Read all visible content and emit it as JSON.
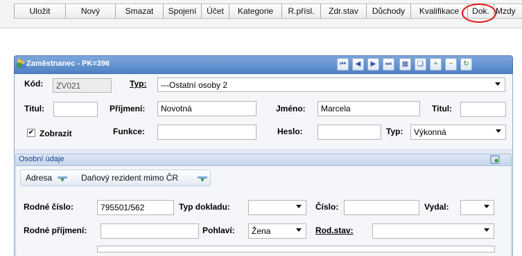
{
  "toolbar": {
    "buttons": [
      "Uložit",
      "Nový",
      "Smazat",
      "Spojení",
      "Účet",
      "Kategorie",
      "R.přísl.",
      "Zdr.stav",
      "Důchody",
      "Kvalifikace",
      "Dok.",
      "Mzdy"
    ]
  },
  "window": {
    "title": "Zaměstnanec - PK=396",
    "nav_buttons": [
      "first",
      "prev",
      "next",
      "last",
      "edit",
      "copy",
      "add",
      "delete",
      "refresh"
    ]
  },
  "form": {
    "kod_label": "Kód:",
    "kod_value": "ZV021",
    "typ_label": "Typ:",
    "typ_value": "---Ostatní osoby 2",
    "titul_label": "Titul:",
    "titul_value": "",
    "prijmeni_label": "Příjmení:",
    "prijmeni_value": "Novotná",
    "jmeno_label": "Jméno:",
    "jmeno_value": "Marcela",
    "titul2_label": "Titul:",
    "titul2_value": "",
    "zobrazit_label": "Zobrazit",
    "zobrazit_checked": true,
    "funkce_label": "Funkce:",
    "funkce_value": "",
    "heslo_label": "Heslo:",
    "heslo_value": "",
    "typ2_label": "Typ:",
    "typ2_value": "Výkonná"
  },
  "section": {
    "title": "Osobní údaje",
    "tabs": [
      "Adresa",
      "Daňový rezident mimo ČR"
    ],
    "rodne_cislo_label": "Rodné číslo:",
    "rodne_cislo_value": "795501/562",
    "typ_dokladu_label": "Typ dokladu:",
    "typ_dokladu_value": "",
    "cislo_label": "Číslo:",
    "cislo_value": "",
    "vydal_label": "Vydal:",
    "vydal_value": "",
    "rodne_prijmeni_label": "Rodné příjmení:",
    "rodne_prijmeni_value": "",
    "pohlavi_label": "Pohlaví:",
    "pohlavi_value": "Žena",
    "rod_stav_label": "Rod.stav:",
    "rod_stav_value": ""
  },
  "colors": {
    "title_bar": "#5f8fcf",
    "highlight_circle": "#e01010",
    "section_text": "#15428b"
  }
}
